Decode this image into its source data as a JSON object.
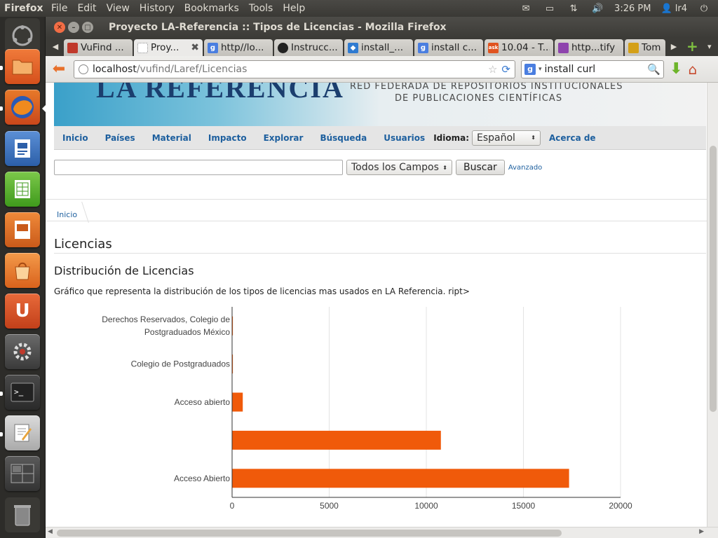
{
  "system": {
    "app_name": "Firefox",
    "menu": [
      "File",
      "Edit",
      "View",
      "History",
      "Bookmarks",
      "Tools",
      "Help"
    ],
    "clock": "3:26 PM",
    "user": "lr4"
  },
  "window": {
    "title": "Proyecto LA-Referencia :: Tipos de Licencias - Mozilla Firefox"
  },
  "tabs": [
    {
      "label": "VuFind ...",
      "favicon_color": "#c0392b"
    },
    {
      "label": "Proy...",
      "favicon_color": "#ffffff",
      "active": true
    },
    {
      "label": "http//lo...",
      "favicon_color": "#4a7ee0"
    },
    {
      "label": "Instrucc...",
      "favicon_color": "#222222"
    },
    {
      "label": "install_...",
      "favicon_color": "#2f7bd1"
    },
    {
      "label": "install c...",
      "favicon_color": "#4a7ee0"
    },
    {
      "label": "10.04 - T...",
      "favicon_color": "#e0531f"
    },
    {
      "label": "http...tify",
      "favicon_color": "#8e44ad"
    },
    {
      "label": "Tom",
      "favicon_color": "#d4a017"
    }
  ],
  "navbar": {
    "url_host": "localhost",
    "url_path": "/vufind/Laref/Licencias",
    "search_value": "install curl"
  },
  "site": {
    "banner_line1": "RED FEDERADA DE REPOSITORIOS INSTITUCIONALES",
    "banner_line2": "DE PUBLICACIONES CIENTÍFICAS",
    "nav": [
      "Inicio",
      "Países",
      "Material",
      "Impacto",
      "Explorar",
      "Búsqueda",
      "Usuarios"
    ],
    "idioma_label": "Idioma:",
    "idioma_value": "Español",
    "acerca": "Acerca de",
    "search_scope": "Todos los Campos",
    "search_button": "Buscar",
    "advanced": "Avanzado",
    "breadcrumb": "Inicio",
    "heading": "Licencias",
    "subheading": "Distribución de Licencias",
    "description": "Gráfico que representa la distribución de los tipos de licencias mas usados en LA Referencia. ript>"
  },
  "chart_data": {
    "type": "bar",
    "orientation": "horizontal",
    "bar_color": "#f05a0a",
    "categories": [
      "Derechos Reservados, Colegio de Postgraduados México",
      "Colegio de Postgraduados",
      "Acceso abierto",
      "",
      "Acceso Abierto"
    ],
    "category_lines": [
      [
        "Derechos Reservados, Colegio de",
        "Postgraduados México"
      ],
      [
        "Colegio de Postgraduados"
      ],
      [
        "Acceso abierto"
      ],
      [],
      [
        "Acceso Abierto"
      ]
    ],
    "values": [
      40,
      40,
      550,
      10750,
      17350
    ],
    "xlim": [
      0,
      20000
    ],
    "xticks": [
      "0",
      "5000",
      "10000",
      "15000",
      "20000"
    ],
    "grid": true
  }
}
